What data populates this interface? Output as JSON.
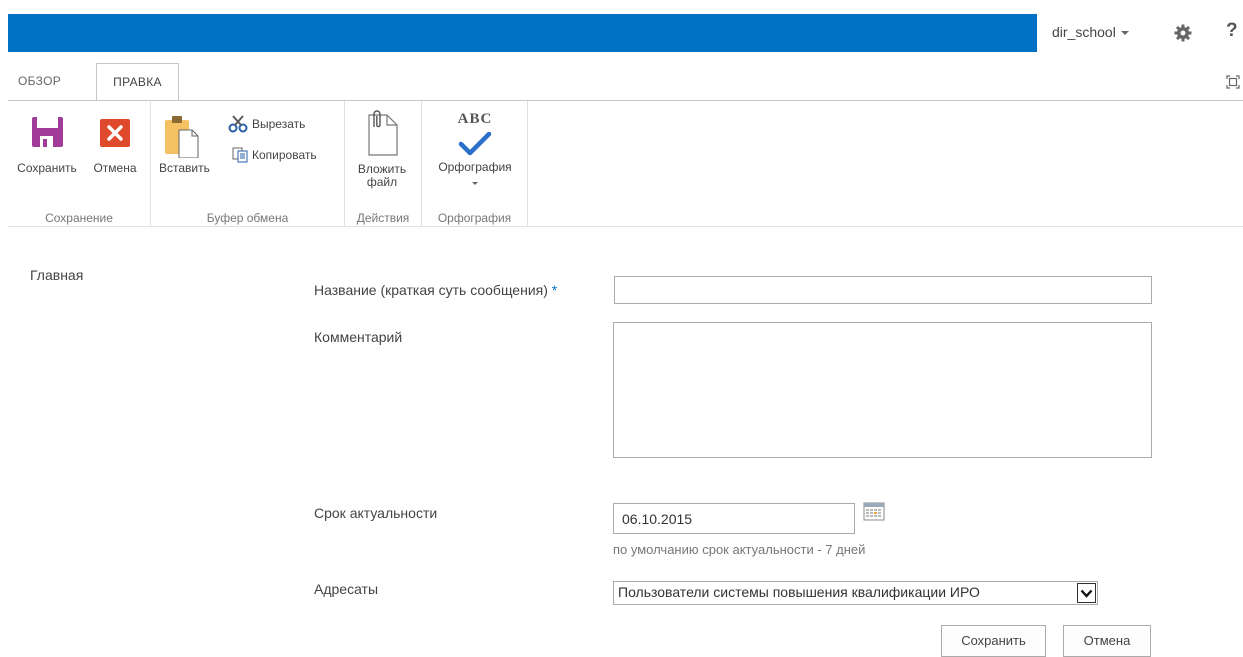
{
  "user": {
    "name": "dir_school"
  },
  "icons": {
    "settings": "gear-icon",
    "help": "?"
  },
  "ribbon_tabs": {
    "overview": "ОБЗОР",
    "edit": "ПРАВКА"
  },
  "ribbon": {
    "save_group": {
      "label": "Сохранение",
      "save": "Сохранить",
      "cancel": "Отмена"
    },
    "clipboard_group": {
      "label": "Буфер обмена",
      "paste": "Вставить",
      "cut": "Вырезать",
      "copy": "Копировать"
    },
    "actions_group": {
      "label": "Действия",
      "attach_line1": "Вложить",
      "attach_line2": "файл"
    },
    "spelling_group": {
      "label": "Орфография",
      "spelling": "Орфография",
      "abc": "ABC"
    }
  },
  "nav": {
    "home": "Главная"
  },
  "form": {
    "title_label": "Название (краткая суть сообщения)",
    "required_marker": "*",
    "title_value": "",
    "comment_label": "Комментарий",
    "comment_value": "",
    "expiry_label": "Срок актуальности",
    "expiry_value": "06.10.2015",
    "expiry_hint": "по умолчанию срок актуальности - 7 дней",
    "recipients_label": "Адресаты",
    "recipients_value": "Пользователи системы повышения квалификации ИРО",
    "save_button": "Сохранить",
    "cancel_button": "Отмена"
  },
  "colors": {
    "suite_bar": "#0072c6",
    "accent": "#0072c6",
    "save_icon": "#a03b9a",
    "cancel_icon": "#e04a2c"
  }
}
